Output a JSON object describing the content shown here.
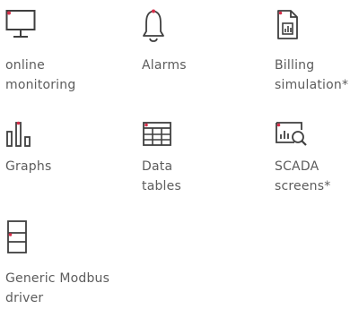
{
  "features": [
    {
      "label": "online\nmonitoring",
      "icon": "monitor-icon"
    },
    {
      "label": "Alarms",
      "icon": "bell-icon"
    },
    {
      "label": "Billing\nsimulation*",
      "icon": "invoice-chart-icon"
    },
    {
      "label": "Graphs",
      "icon": "bar-graph-icon"
    },
    {
      "label": "Data\ntables",
      "icon": "table-grid-icon"
    },
    {
      "label": "SCADA\nscreens*",
      "icon": "chart-magnifier-icon"
    },
    {
      "label": "Generic Modbus\ndriver",
      "icon": "modbus-device-icon"
    }
  ],
  "colors": {
    "icon_stroke": "#3f3f3f",
    "accent_dot": "#d62f4a",
    "text": "#5c5c5c"
  }
}
